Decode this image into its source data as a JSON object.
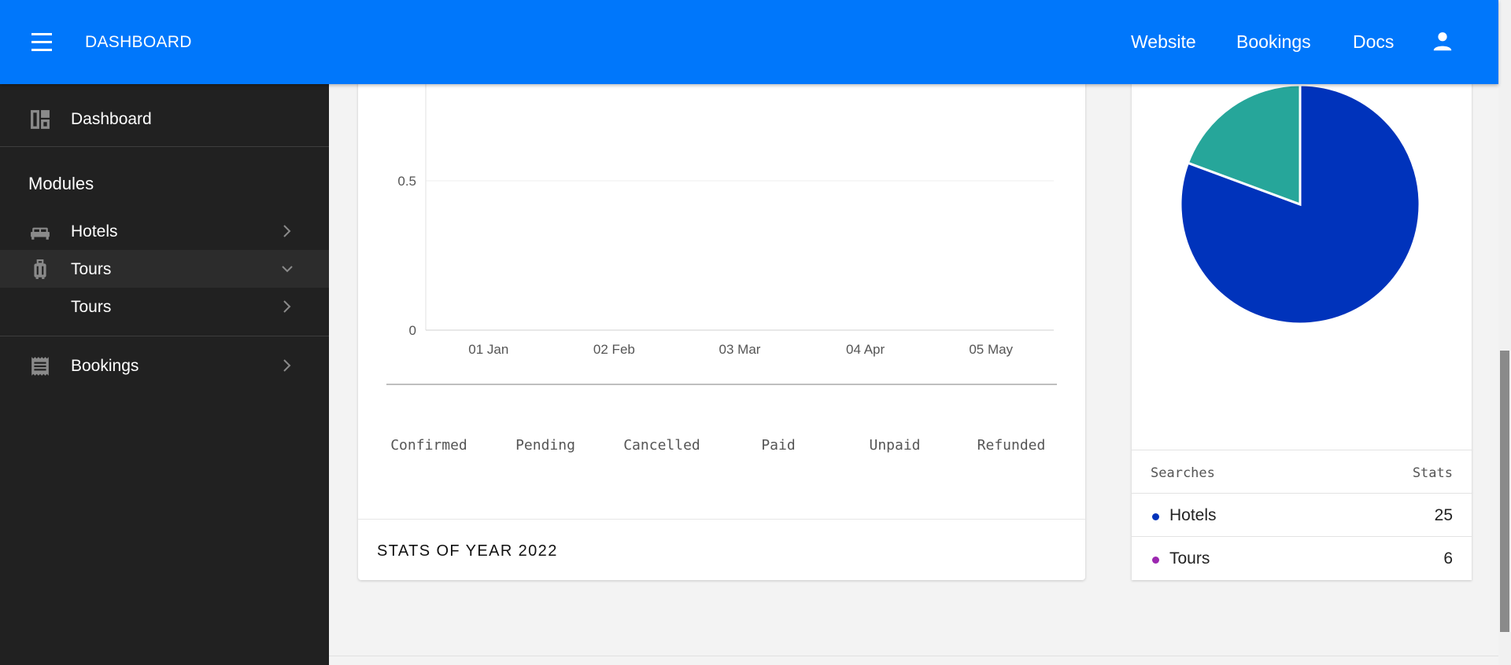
{
  "topbar": {
    "brand": "DASHBOARD",
    "nav": [
      "Website",
      "Bookings",
      "Docs"
    ],
    "menu_icon": "hamburger-icon",
    "user_icon": "account-icon",
    "color": "#0077fb"
  },
  "sidebar": {
    "dashboard": "Dashboard",
    "modules_heading": "Modules",
    "items": [
      {
        "label": "Hotels",
        "icon": "bed-icon"
      },
      {
        "label": "Tours",
        "icon": "luggage-icon",
        "expanded": true
      },
      {
        "label": "Tours",
        "icon": ""
      },
      {
        "label": "Bookings",
        "icon": "receipt-icon"
      }
    ]
  },
  "chart": {
    "statuses": [
      "Confirmed",
      "Pending",
      "Cancelled",
      "Paid",
      "Unpaid",
      "Refunded"
    ],
    "footer": "STATS OF YEAR 2022"
  },
  "chart_data": [
    {
      "type": "line",
      "x": [
        "01 Jan",
        "02 Feb",
        "03 Mar",
        "04 Apr",
        "05 May"
      ],
      "y_ticks": [
        0,
        0.5
      ],
      "ylim": [
        0,
        1
      ],
      "series": [],
      "grid": true
    },
    {
      "type": "pie",
      "categories": [
        "Hotels",
        "Tours"
      ],
      "values": [
        25,
        6
      ],
      "colors": [
        "#0033bb",
        "#26a69a"
      ]
    }
  ],
  "stats": {
    "headers": [
      "Searches",
      "Stats"
    ],
    "rows": [
      {
        "name": "Hotels",
        "value": "25",
        "dot": "#0033bb"
      },
      {
        "name": "Tours",
        "value": "6",
        "dot": "#9c27b0"
      }
    ]
  }
}
